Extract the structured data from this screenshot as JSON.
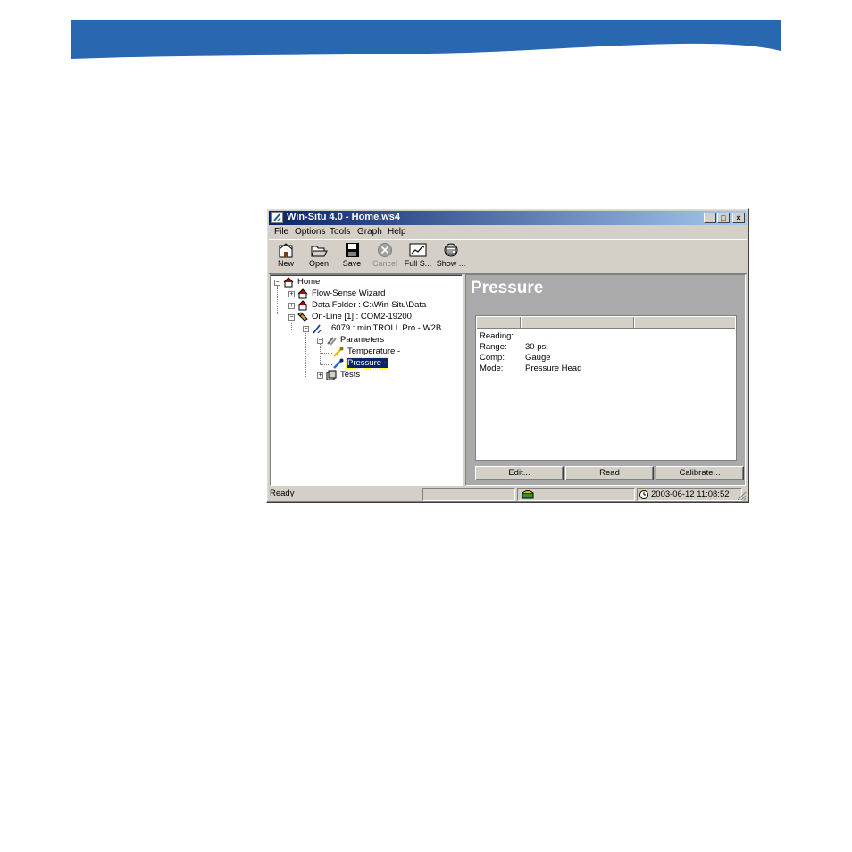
{
  "colors": {
    "banner": "#2a67b1",
    "titlebar": "#0a246a",
    "selection": "#0a246a",
    "detail_bg": "#aaaaaa"
  },
  "window": {
    "title": "Win-Situ 4.0 - Home.ws4",
    "controls": [
      "minimize-icon",
      "maximize-icon",
      "close-icon"
    ]
  },
  "menu": [
    "File",
    "Options",
    "Tools",
    "Graph",
    "Help"
  ],
  "toolbar": [
    {
      "label": "New",
      "icon": "new-home-icon",
      "enabled": true
    },
    {
      "label": "Open",
      "icon": "open-folder-icon",
      "enabled": true
    },
    {
      "label": "Save",
      "icon": "floppy-disk-icon",
      "enabled": true
    },
    {
      "label": "Cancel",
      "icon": "cancel-x-icon",
      "enabled": false
    },
    {
      "label": "Full S...",
      "icon": "graph-icon",
      "enabled": true
    },
    {
      "label": "Show ...",
      "icon": "show-window-icon",
      "enabled": true
    }
  ],
  "tree": {
    "home": "Home",
    "flow_sense": "Flow-Sense Wizard",
    "data_folder": "Data Folder : C:\\Win-Situ\\Data",
    "online": "On-Line [1] : COM2-19200",
    "device": "6079 : miniTROLL Pro - W2B",
    "parameters": "Parameters",
    "temperature": "Temperature -",
    "pressure": "Pressure -",
    "tests": "Tests"
  },
  "detail": {
    "heading": "Pressure",
    "rows": [
      {
        "key": "Reading:",
        "value": ""
      },
      {
        "key": "Range:",
        "value": "30 psi"
      },
      {
        "key": "Comp:",
        "value": "Gauge"
      },
      {
        "key": "Mode:",
        "value": "Pressure Head"
      }
    ],
    "buttons": {
      "edit": "Edit...",
      "read": "Read",
      "calibrate": "Calibrate..."
    }
  },
  "status": {
    "text": "Ready",
    "datetime": "2003-06-12 11:08:52"
  }
}
